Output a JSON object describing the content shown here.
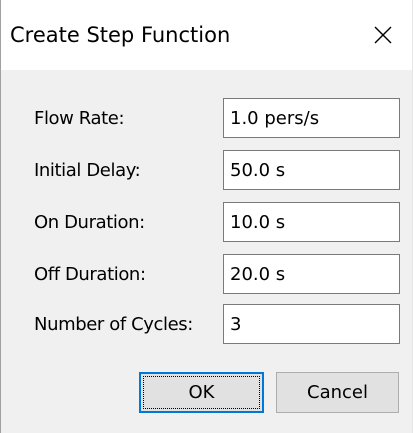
{
  "window": {
    "title": "Create Step Function",
    "close_glyph": "close-icon"
  },
  "form": {
    "fields": [
      {
        "label": "Flow Rate:",
        "value": "1.0 pers/s"
      },
      {
        "label": "Initial Delay:",
        "value": "50.0 s"
      },
      {
        "label": "On Duration:",
        "value": "10.0 s"
      },
      {
        "label": "Off Duration:",
        "value": "20.0 s"
      },
      {
        "label": "Number of Cycles:",
        "value": "3"
      }
    ]
  },
  "buttons": {
    "ok_label": "OK",
    "cancel_label": "Cancel"
  },
  "colors": {
    "dialog_background": "#f0f0f0",
    "titlebar_background": "#ffffff",
    "default_button_border": "#0078d7"
  }
}
